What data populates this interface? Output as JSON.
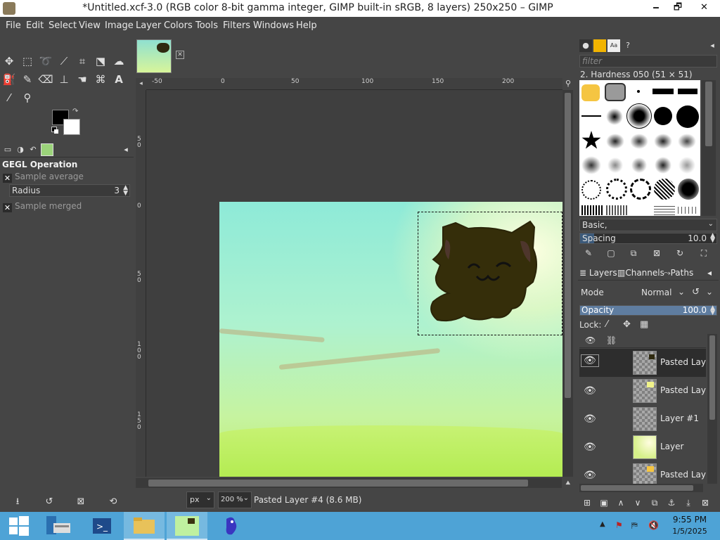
{
  "window": {
    "title": "*Untitled.xcf-3.0 (RGB color 8-bit gamma integer, GIMP built-in sRGB, 8 layers) 250x250 – GIMP",
    "minimize": "🗕",
    "maximize": "🗗",
    "close": "✕"
  },
  "menu": [
    "File",
    "Edit",
    "Select",
    "View",
    "Image",
    "Layer",
    "Colors",
    "Tools",
    "Filters",
    "Windows",
    "Help"
  ],
  "colors": {
    "foreground": "#000000",
    "background": "#ffffff"
  },
  "tool_options": {
    "title": "GEGL Operation",
    "sample_average": "Sample average",
    "radius_label": "Radius",
    "radius_value": "3",
    "sample_merged": "Sample merged"
  },
  "ruler": {
    "top_labels": [
      "-50",
      "0",
      "50",
      "100",
      "150",
      "200"
    ],
    "left_labels": [
      "5\n0",
      "0",
      "5\n0",
      "1\n0\n0",
      "1\n5\n0"
    ]
  },
  "statusbar": {
    "unit": "px",
    "zoom": "200 %",
    "message": "Pasted Layer #4 (8.6 MB)"
  },
  "brushes": {
    "filter_placeholder": "filter",
    "selected_name": "2. Hardness 050 (51 × 51)",
    "category": "Basic,",
    "spacing_label": "Spacing",
    "spacing_value": "10.0"
  },
  "layers_panel": {
    "tab_layers": "Layers",
    "tab_channels": "Channels",
    "tab_paths": "Paths",
    "mode_label": "Mode",
    "mode_value": "Normal",
    "opacity_label": "Opacity",
    "opacity_value": "100.0",
    "lock_label": "Lock:",
    "layers": [
      {
        "name": "Pasted Layer",
        "visible": true,
        "selected": true
      },
      {
        "name": "Pasted Layer",
        "visible": true,
        "selected": false
      },
      {
        "name": "Layer #1",
        "visible": true,
        "selected": false
      },
      {
        "name": "Layer",
        "visible": true,
        "selected": false
      },
      {
        "name": "Pasted Layer",
        "visible": true,
        "selected": false
      }
    ]
  },
  "taskbar": {
    "time": "9:55 PM",
    "date": "1/5/2025"
  }
}
